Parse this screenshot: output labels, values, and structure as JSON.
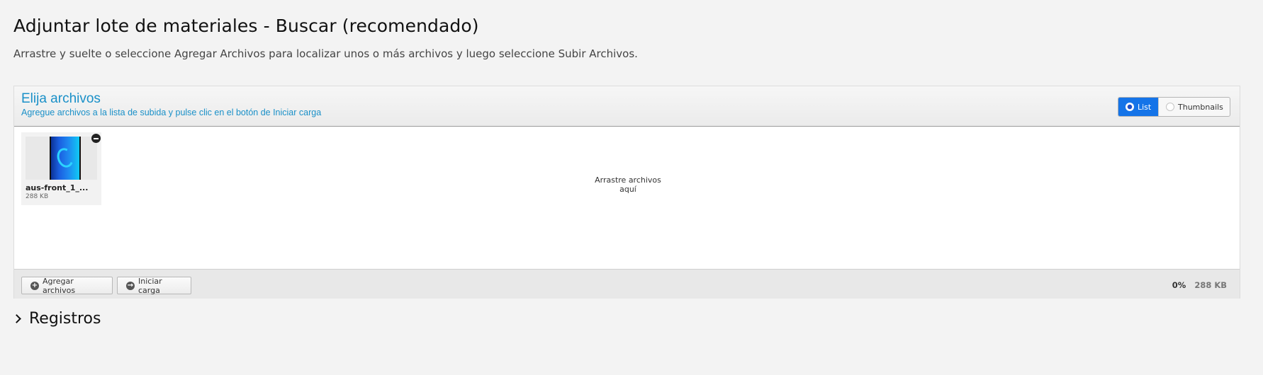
{
  "page": {
    "title": "Adjuntar lote de materiales - Buscar (recomendado)",
    "subtitle": "Arrastre y suelte o seleccione Agregar Archivos para localizar unos o más archivos y luego seleccione Subir Archivos."
  },
  "uploader": {
    "header_title": "Elija archivos",
    "header_subtitle": "Agregue archivos a la lista de subida y pulse clic en el botón de Iniciar carga",
    "view_options": [
      {
        "label": "List",
        "selected": true
      },
      {
        "label": "Thumbnails",
        "selected": false
      }
    ],
    "drop_hint": "Arrastre archivos aquí",
    "files": [
      {
        "name": "aus-front_1_...",
        "size": "288 KB"
      }
    ],
    "footer": {
      "add_label": "Agregar archivos",
      "start_label": "Iniciar carga",
      "percent": "0%",
      "total_size": "288 KB"
    }
  },
  "sections": {
    "registros_label": "Registros"
  },
  "colors": {
    "accent": "#1a90c8",
    "toggle_active": "#1574e8",
    "background": "#f3f3f3"
  },
  "icons": {
    "add": "plus-circle-icon",
    "start": "arrow-circle-icon",
    "remove": "minus-circle-icon",
    "section_toggle": "chevron-right-icon"
  }
}
